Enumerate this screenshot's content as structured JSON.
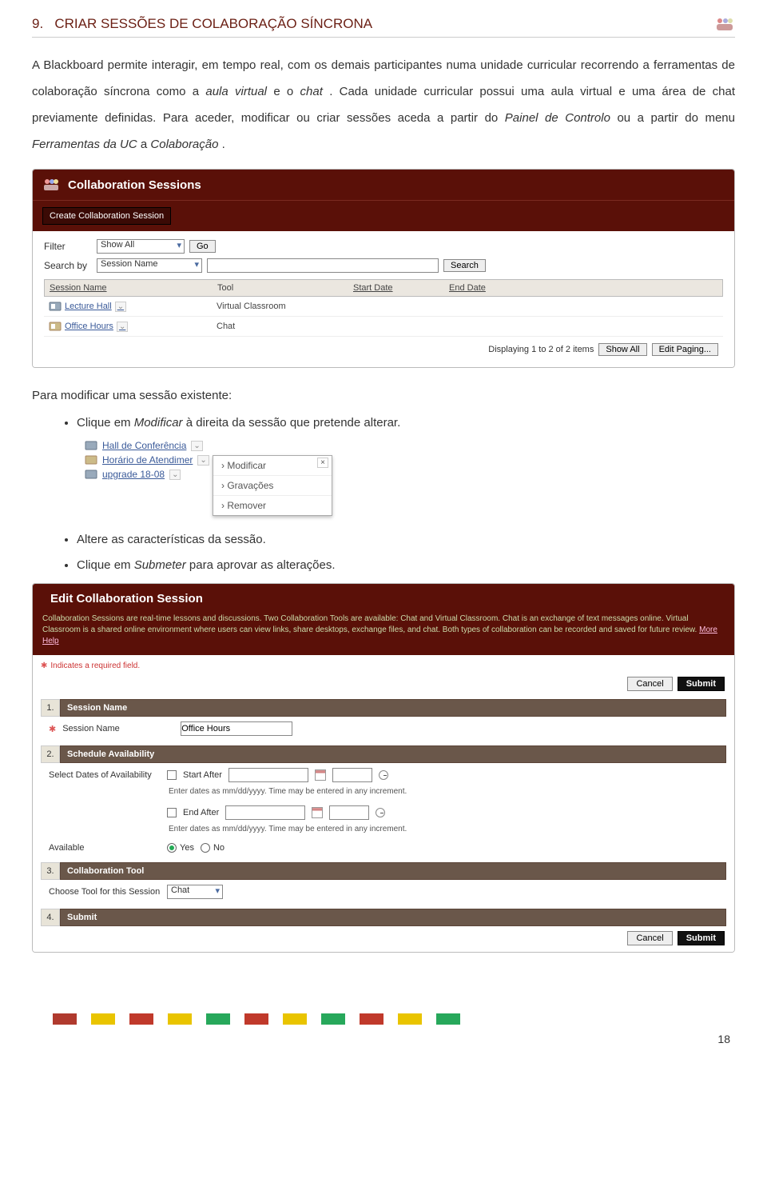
{
  "doc": {
    "section_number": "9.",
    "section_title": "CRIAR SESSÕES DE COLABORAÇÃO SÍNCRONA",
    "para1_a": "A Blackboard permite interagir, em tempo real, com os demais participantes numa unidade curricular recorrendo a ferramentas de colaboração síncrona como a ",
    "para1_i1": "aula virtual",
    "para1_b": " e o ",
    "para1_i2": "chat",
    "para1_c": ". Cada unidade curricular possui uma aula virtual e uma área de chat previamente definidas. Para aceder, modificar ou criar sessões aceda a partir do ",
    "para1_i3": "Painel de Controlo",
    "para1_d": " ou a partir do menu ",
    "para1_i4": "Ferramentas da UC",
    "para1_e": " a ",
    "para1_i5": "Colaboração",
    "para1_f": ".",
    "section2_title": "Para modificar uma sessão existente:",
    "bullet1_a": "Clique em ",
    "bullet1_i": "Modificar ",
    "bullet1_b": " à direita da sessão que pretende alterar.",
    "bullet2": "Altere as características da sessão.",
    "bullet3_a": "Clique em ",
    "bullet3_i": "Submeter",
    "bullet3_b": " para aprovar as alterações.",
    "page_number": "18"
  },
  "collab": {
    "title": "Collaboration Sessions",
    "create": "Create Collaboration Session",
    "filter_label": "Filter",
    "filter_value": "Show All",
    "go": "Go",
    "searchby_label": "Search by",
    "searchby_value": "Session Name",
    "search": "Search",
    "cols": {
      "name": "Session Name",
      "tool": "Tool",
      "start": "Start Date",
      "end": "End Date"
    },
    "rows": [
      {
        "name": "Lecture Hall",
        "tool": "Virtual Classroom"
      },
      {
        "name": "Office Hours",
        "tool": "Chat"
      }
    ],
    "paging": "Displaying 1 to 2 of 2 items",
    "showall": "Show All",
    "editpaging": "Edit Paging..."
  },
  "ctx": {
    "row1": "Hall de Conferência",
    "row2": "Horário de Atendimer",
    "row3": "upgrade 18-08",
    "item1": "Modificar",
    "item2": "Gravações",
    "item3": "Remover"
  },
  "edit": {
    "title": "Edit Collaboration Session",
    "desc": "Collaboration Sessions are real-time lessons and discussions. Two Collaboration Tools are available: Chat and Virtual Classroom. Chat is an exchange of text messages online. Virtual Classroom is a shared online environment where users can view links, share desktops, exchange files, and chat. Both types of collaboration can be recorded and saved for future review. ",
    "more": "More Help",
    "req": "Indicates a required field.",
    "cancel": "Cancel",
    "submit": "Submit",
    "s1": "Session Name",
    "s1_label": "Session Name",
    "s1_value": "Office Hours",
    "s2": "Schedule Availability",
    "s2_label": "Select Dates of Availability",
    "start_after": "Start After",
    "end_after": "End After",
    "hint": "Enter dates as mm/dd/yyyy. Time may be entered in any increment.",
    "available": "Available",
    "yes": "Yes",
    "no": "No",
    "s3": "Collaboration Tool",
    "s3_label": "Choose Tool for this Session",
    "s3_value": "Chat",
    "s4": "Submit"
  },
  "colors": [
    "#b03a2e",
    "#e9c400",
    "#c0392b",
    "#e9c400",
    "#27a85b",
    "#c0392b",
    "#e9c400",
    "#27a85b",
    "#c0392b",
    "#e9c400",
    "#27a85b"
  ]
}
